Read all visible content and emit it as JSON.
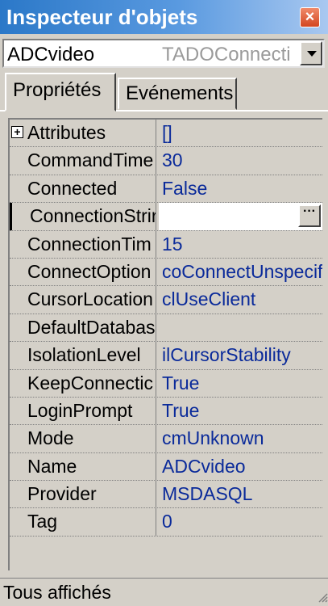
{
  "window": {
    "title": "Inspecteur d'objets",
    "close_glyph": "×"
  },
  "object_combo": {
    "name": "ADCvideo",
    "type": "TADOConnecti"
  },
  "tabs": [
    {
      "label": "Propriétés",
      "active": true
    },
    {
      "label": "Evénements",
      "active": false
    }
  ],
  "properties": [
    {
      "name": "Attributes",
      "value": "[]",
      "expandable": true
    },
    {
      "name": "CommandTime",
      "value": "30"
    },
    {
      "name": "Connected",
      "value": "False"
    },
    {
      "name": "ConnectionStrir",
      "value": "",
      "selected": true
    },
    {
      "name": "ConnectionTim",
      "value": "15"
    },
    {
      "name": "ConnectOption",
      "value": "coConnectUnspecifi"
    },
    {
      "name": "CursorLocation",
      "value": "clUseClient"
    },
    {
      "name": "DefaultDatabas",
      "value": ""
    },
    {
      "name": "IsolationLevel",
      "value": "ilCursorStability"
    },
    {
      "name": "KeepConnectic",
      "value": "True"
    },
    {
      "name": "LoginPrompt",
      "value": "True"
    },
    {
      "name": "Mode",
      "value": "cmUnknown"
    },
    {
      "name": "Name",
      "value": "ADCvideo"
    },
    {
      "name": "Provider",
      "value": "MSDASQL"
    },
    {
      "name": "Tag",
      "value": "0"
    }
  ],
  "expand_glyph": "+",
  "ellipsis_glyph": "···",
  "status_bar": {
    "text": "Tous affichés"
  },
  "colors": {
    "title_gradient_start": "#2b78c8",
    "value_text": "#0a2a9a",
    "face": "#d4d0c8"
  }
}
